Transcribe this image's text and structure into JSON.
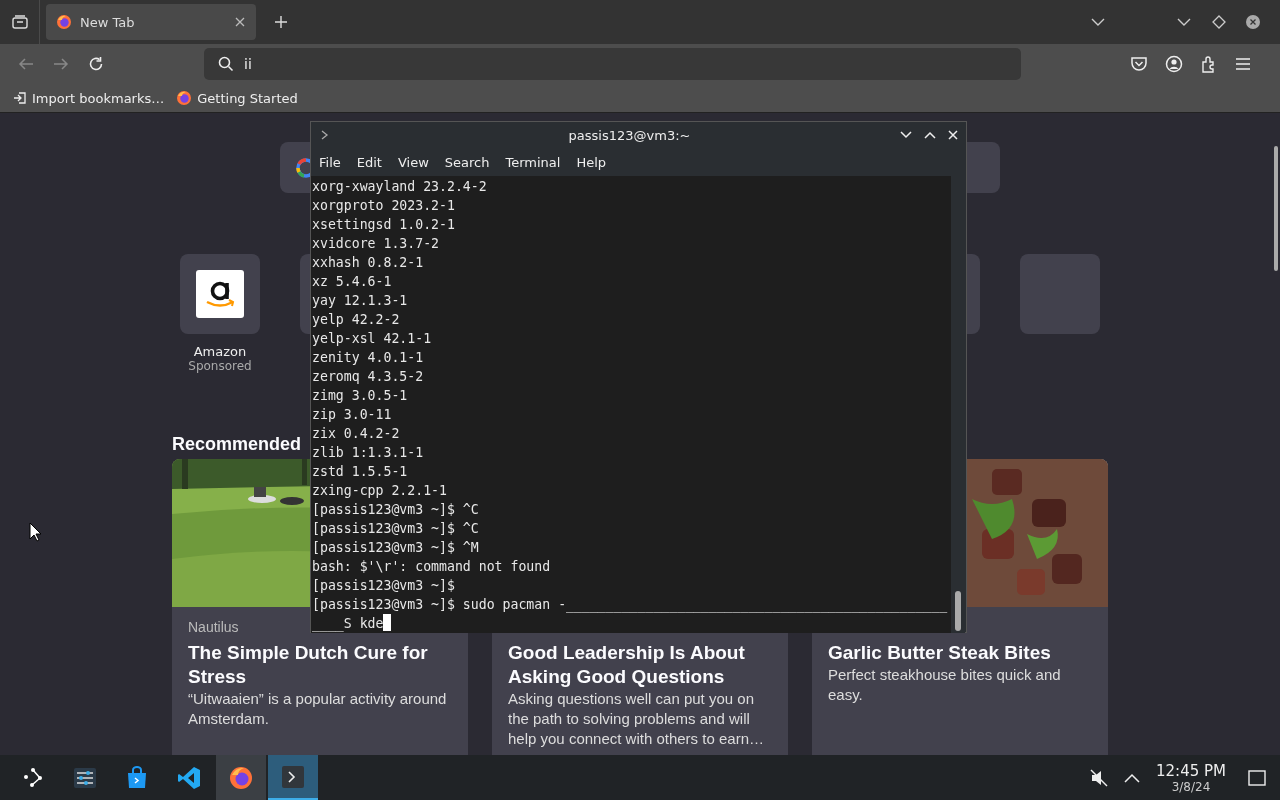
{
  "browser": {
    "tabs": [
      {
        "title": "New Tab",
        "selected": true
      }
    ],
    "address_bar": {
      "value": "ii"
    },
    "bookmarks": [
      {
        "label": "Import bookmarks…",
        "kind": "import"
      },
      {
        "label": "Getting Started",
        "kind": "firefox"
      }
    ],
    "top_sites": [
      {
        "label": "Amazon",
        "sublabel": "Sponsored",
        "kind": "amazon"
      }
    ],
    "recommended_heading": "Recommended",
    "stories": [
      {
        "source": "Nautilus",
        "title": "The Simple Dutch Cure for Stress",
        "excerpt": "“Uitwaaien” is a popular activity around Amsterdam.",
        "kind": "picture"
      },
      {
        "title": "Good Leadership Is About Asking Good Questions",
        "excerpt": "Asking questions well can put you on the path to solving problems and will help you connect with others to earn…",
        "kind": "text"
      },
      {
        "title": "Garlic Butter Steak Bites",
        "excerpt": "Perfect steakhouse bites quick and easy.",
        "kind": "picture"
      }
    ]
  },
  "terminal": {
    "title": "passis123@vm3:~",
    "menu": [
      "File",
      "Edit",
      "View",
      "Search",
      "Terminal",
      "Help"
    ],
    "lines": [
      "xorg-xwayland 23.2.4-2",
      "xorgproto 2023.2-1",
      "xsettingsd 1.0.2-1",
      "xvidcore 1.3.7-2",
      "xxhash 0.8.2-1",
      "xz 5.4.6-1",
      "yay 12.1.3-1",
      "yelp 42.2-2",
      "yelp-xsl 42.1-1",
      "zenity 4.0.1-1",
      "zeromq 4.3.5-2",
      "zimg 3.0.5-1",
      "zip 3.0-11",
      "zix 0.4.2-2",
      "zlib 1:1.3.1-1",
      "zstd 1.5.5-1",
      "zxing-cpp 2.2.1-1",
      "[passis123@vm3 ~]$ ^C",
      "[passis123@vm3 ~]$ ^C",
      "[passis123@vm3 ~]$ ^M",
      "bash: $'\\r': command not found",
      "[passis123@vm3 ~]$",
      "[passis123@vm3 ~]$ sudo pacman -________________________________________________",
      "____S kde"
    ]
  },
  "taskbar": {
    "apps": [
      {
        "kind": "launcher",
        "running": false,
        "selected": false
      },
      {
        "kind": "settings",
        "running": false,
        "selected": false
      },
      {
        "kind": "store",
        "running": false,
        "selected": false
      },
      {
        "kind": "code",
        "running": false,
        "selected": false
      },
      {
        "kind": "firefox",
        "running": true,
        "selected": false
      },
      {
        "kind": "terminal",
        "running": true,
        "selected": true
      }
    ],
    "volume_muted": true,
    "time": "12:45 PM",
    "date": "3/8/24"
  }
}
